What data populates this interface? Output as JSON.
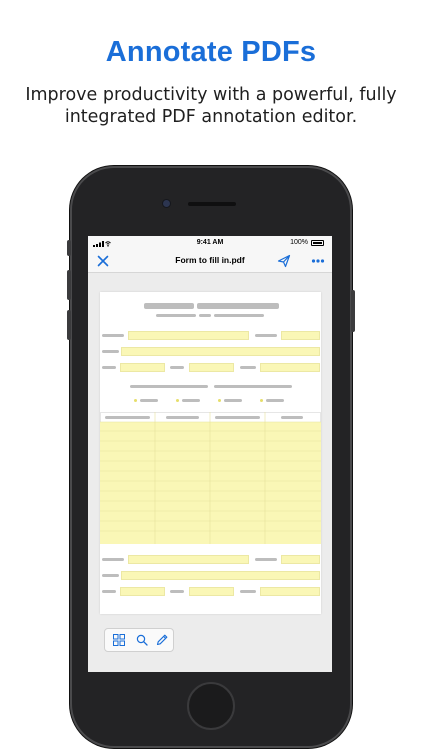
{
  "headline": "Annotate PDFs",
  "subline": "Improve productivity with a powerful, fully integrated PDF annotation editor.",
  "status_bar": {
    "time": "9:41 AM",
    "battery": "100%"
  },
  "nav": {
    "title": "Form to fill in.pdf"
  },
  "icons": {
    "close": "close-icon",
    "share": "paper-plane-icon",
    "more": "more-icon",
    "thumbnails": "grid-icon",
    "search": "search-icon",
    "annotate": "pencil-icon"
  },
  "colors": {
    "accent": "#1a6ed8",
    "form_field": "#faf7b6"
  }
}
